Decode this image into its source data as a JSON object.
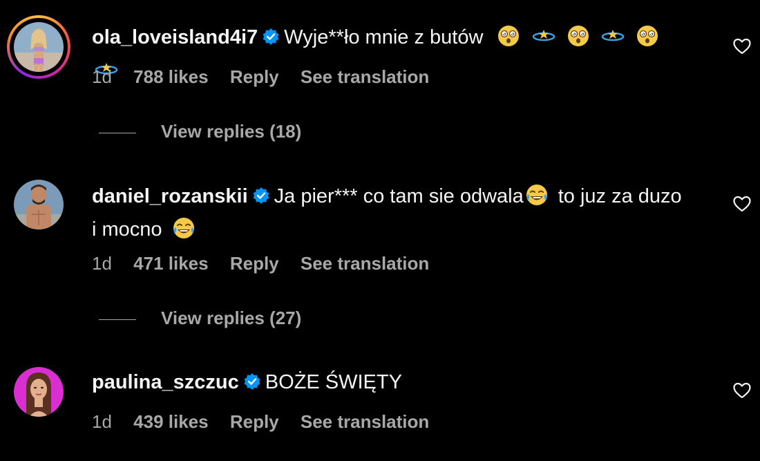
{
  "comments": [
    {
      "username": "ola_loveisland4i7",
      "text": "Wyje**ło mnie z butów",
      "emojis": [
        "dizzy-face",
        "dizzy-star",
        "dizzy-face",
        "dizzy-star",
        "dizzy-face",
        "dizzy-star"
      ],
      "time": "1d",
      "likes": "788 likes",
      "reply": "Reply",
      "translate": "See translation",
      "replies": "View replies (18)",
      "avatar_ring": true
    },
    {
      "username": "daniel_rozanskii",
      "text_part1": "Ja pier*** co tam sie odwala",
      "text_part2": "to juz za duzo i mocno",
      "emojis": [
        "tears-of-joy",
        "tears-of-joy"
      ],
      "time": "1d",
      "likes": "471 likes",
      "reply": "Reply",
      "translate": "See translation",
      "replies": "View replies (27)"
    },
    {
      "username": "paulina_szczuc",
      "text": "BOŻE ŚWIĘTY",
      "time": "1d",
      "likes": "439 likes",
      "reply": "Reply",
      "translate": "See translation"
    }
  ],
  "colors": {
    "background": "#000000",
    "text": "#f5f5f5",
    "secondary": "#a8a8a8",
    "verified": "#0095f6"
  },
  "icons": {
    "verified": "verified-badge-icon",
    "like": "heart-outline-icon"
  }
}
